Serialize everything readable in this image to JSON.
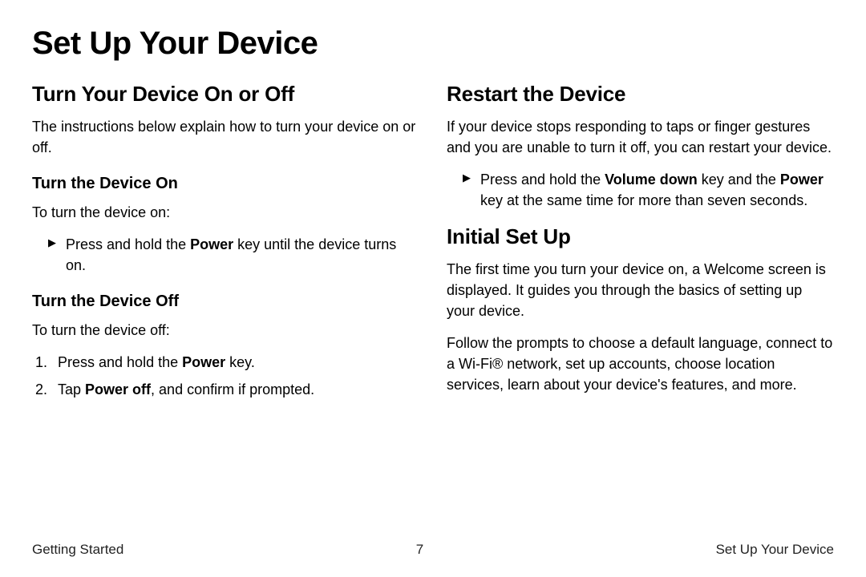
{
  "page_title": "Set Up Your Device",
  "left": {
    "h2": "Turn Your Device On or Off",
    "intro": "The instructions below explain how to turn your device on or off.",
    "turn_on": {
      "h3": "Turn the Device On",
      "lead": "To turn the device on:",
      "step_pre": "Press and hold the ",
      "step_bold": "Power",
      "step_post": " key until the device turns on."
    },
    "turn_off": {
      "h3": "Turn the Device Off",
      "lead": "To turn the device off:",
      "s1_pre": "Press and hold the ",
      "s1_bold": "Power",
      "s1_post": " key.",
      "s2_pre": "Tap ",
      "s2_bold": "Power off",
      "s2_post": ", and confirm if prompted."
    }
  },
  "right": {
    "restart": {
      "h2": "Restart the Device",
      "intro": "If your device stops responding to taps or finger gestures and you are unable to turn it off, you can restart your device.",
      "step_pre": "Press and hold the ",
      "b1": "Volume down",
      "mid": " key and the ",
      "b2": "Power",
      "step_post": " key at the same time for more than seven seconds."
    },
    "initial": {
      "h2": "Initial Set Up",
      "p1": "The first time you turn your device on, a Welcome screen is displayed. It guides you through the basics of setting up your device.",
      "p2": "Follow the prompts to choose a default language, connect to a Wi-Fi® network, set up accounts, choose location services, learn about your device's features, and more."
    }
  },
  "footer": {
    "left": "Getting Started",
    "center": "7",
    "right": "Set Up Your Device"
  }
}
